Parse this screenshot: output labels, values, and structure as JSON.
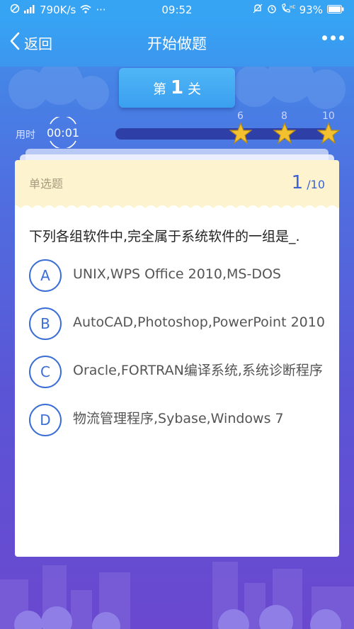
{
  "status_bar": {
    "network_speed": "790K/s",
    "dots": "···",
    "time": "09:52",
    "battery": "93%"
  },
  "nav": {
    "back_label": "返回",
    "title": "开始做题"
  },
  "level": {
    "prefix": "第",
    "number": "1",
    "suffix": "关"
  },
  "timer": {
    "label": "用时",
    "value": "00:01"
  },
  "progress": {
    "fill_fraction": 0,
    "milestones": [
      "6",
      "8",
      "10"
    ]
  },
  "card": {
    "question_type": "单选题",
    "current": "1",
    "total": "/10",
    "question": "下列各组软件中,完全属于系统软件的一组是_.",
    "options": [
      {
        "letter": "A",
        "text": "UNIX,WPS Office 2010,MS-DOS"
      },
      {
        "letter": "B",
        "text": "AutoCAD,Photoshop,PowerPoint 2010"
      },
      {
        "letter": "C",
        "text": "Oracle,FORTRAN编译系统,系统诊断程序"
      },
      {
        "letter": "D",
        "text": "物流管理程序,Sybase,Windows 7"
      }
    ]
  },
  "colors": {
    "accent": "#3a6ed6",
    "header_bg": "#fdf3cf",
    "star": "#f3c12f"
  },
  "icons": [
    "no-disturb-icon",
    "signal-icon",
    "wifi-icon",
    "alarm-off-icon",
    "alarm-icon",
    "hd-call-icon",
    "battery-icon",
    "back-chevron-icon",
    "more-icon",
    "star-icon"
  ]
}
